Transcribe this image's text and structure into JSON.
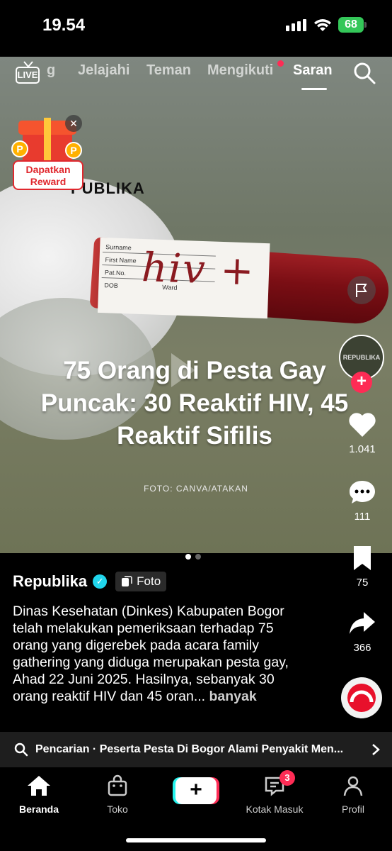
{
  "status": {
    "time": "19.54",
    "battery": "68"
  },
  "top_nav": {
    "live_label": "LIVE",
    "tabs": [
      {
        "label": "g"
      },
      {
        "label": "Jelajahi"
      },
      {
        "label": "Teman"
      },
      {
        "label": "Mengikuti"
      },
      {
        "label": "Saran"
      }
    ],
    "active_tab": "Saran"
  },
  "reward": {
    "label": "Dapatkan Reward",
    "coin_letter": "P"
  },
  "media": {
    "publisher_logo": "PUBLIKA",
    "tube_label_fields": [
      "Surname",
      "First Name",
      "Pat.No.",
      "DOB",
      "Ward"
    ],
    "handwriting": "hiv +",
    "headline": "75 Orang di Pesta Gay Puncak: 30 Reaktif HIV, 45 Reaktif Sifilis",
    "photo_credit": "FOTO: CANVA/ATAKAN",
    "slide_count": 2,
    "active_slide": 1
  },
  "actions": {
    "avatar_text": "REPUBLIKA",
    "likes": "1.041",
    "comments": "111",
    "saves": "75",
    "shares": "366"
  },
  "caption": {
    "author": "Republika",
    "type_badge": "Foto",
    "text": "Dinas Kesehatan (Dinkes) Kabupaten Bogor telah melakukan pemeriksaan terhadap 75 orang yang digerebek pada acara family gathering yang diduga merupakan pesta gay, Ahad 22 Juni 2025. Hasilnya, sebanyak 30 orang reaktif HIV dan 45 oran...",
    "more": "banyak"
  },
  "search_suggestion": "Pencarian · Peserta Pesta Di Bogor Alami Penyakit Men...",
  "bottom_nav": {
    "home": "Beranda",
    "shop": "Toko",
    "inbox": "Kotak Masuk",
    "inbox_badge": "3",
    "profile": "Profil"
  },
  "colors": {
    "accent": "#fe2c55",
    "cyan": "#25f4ee",
    "verified": "#20d5ec",
    "battery": "#34c759"
  }
}
